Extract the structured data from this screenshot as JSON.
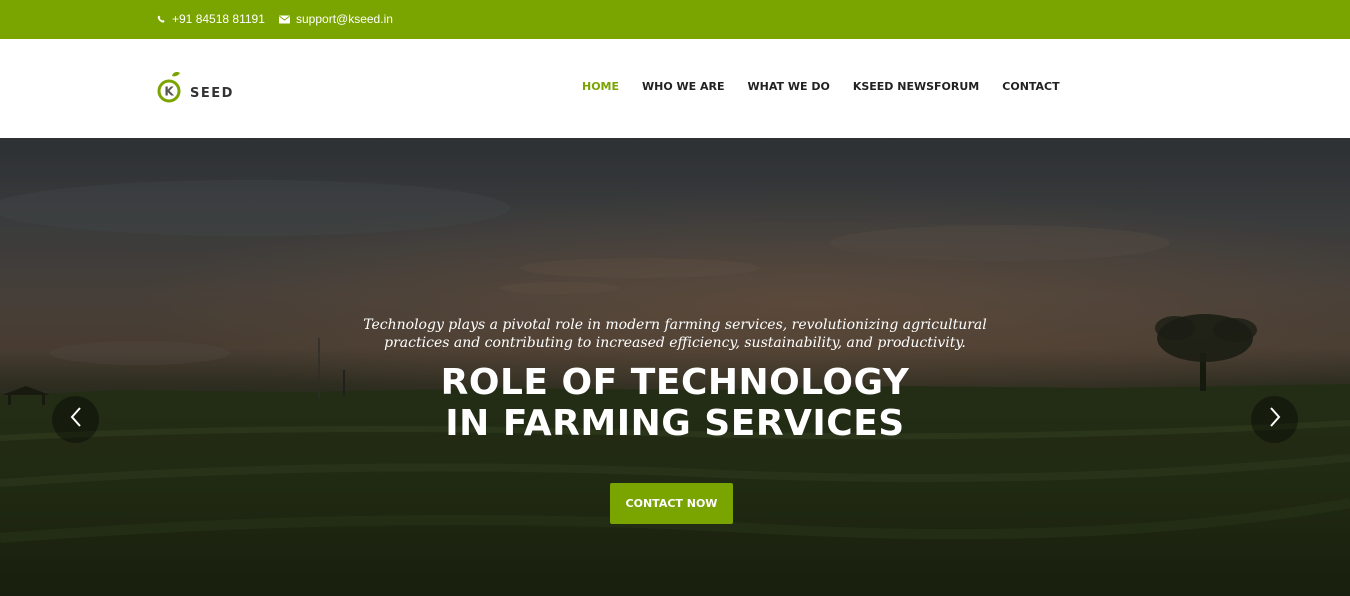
{
  "topbar": {
    "phone": "+91 84518 81191",
    "email": "support@kseed.in",
    "phone_icon": "phone-icon",
    "email_icon": "envelope-icon"
  },
  "logo": {
    "mark_letter": "K",
    "word": "SEED"
  },
  "nav": {
    "items": [
      {
        "label": "HOME",
        "active": true
      },
      {
        "label": "WHO WE ARE",
        "active": false
      },
      {
        "label": "WHAT WE DO",
        "active": false
      },
      {
        "label": "KSEED NEWSFORUM",
        "active": false
      },
      {
        "label": "CONTACT",
        "active": false
      }
    ]
  },
  "hero": {
    "tagline_line1": "Technology plays a pivotal role in modern farming services, revolutionizing agricultural",
    "tagline_line2": "practices and contributing to increased efficiency, sustainability, and productivity.",
    "headline_line1": "ROLE OF TECHNOLOGY",
    "headline_line2": "IN FARMING SERVICES",
    "cta_label": "CONTACT NOW",
    "prev_icon": "chevron-left-icon",
    "next_icon": "chevron-right-icon"
  },
  "colors": {
    "brand_green": "#7aa400",
    "nav_text": "#222222"
  }
}
